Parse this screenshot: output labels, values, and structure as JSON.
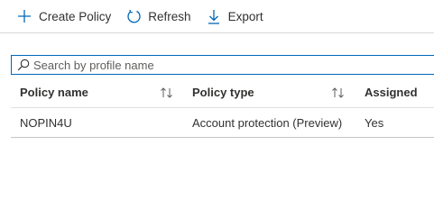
{
  "toolbar": {
    "create_label": "Create Policy",
    "refresh_label": "Refresh",
    "export_label": "Export"
  },
  "search": {
    "placeholder": "Search by profile name",
    "value": ""
  },
  "table": {
    "headers": [
      "Policy name",
      "Policy type",
      "Assigned"
    ],
    "rows": [
      {
        "name": "NOPIN4U",
        "type": "Account protection (Preview)",
        "assigned": "Yes"
      }
    ]
  },
  "colors": {
    "accent": "#0067b8",
    "text": "#323130",
    "border": "#d8d8d8"
  },
  "icons": [
    "plus-icon",
    "refresh-icon",
    "download-icon",
    "search-icon",
    "sort-icon"
  ]
}
